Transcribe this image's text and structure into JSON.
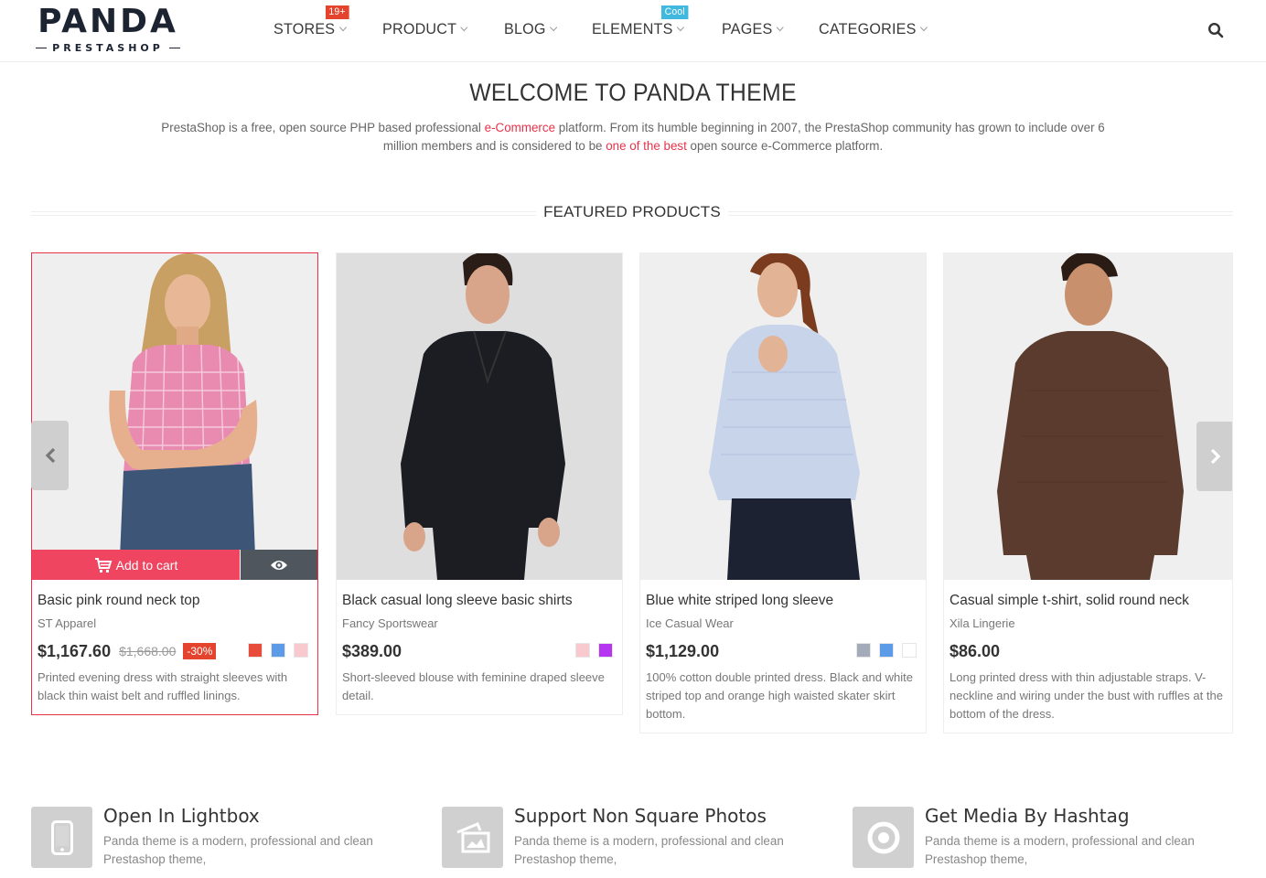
{
  "logo": {
    "main": "PANDA",
    "sub": "PRESTASHOP"
  },
  "nav": {
    "items": [
      {
        "label": "STORES",
        "badge": "19+",
        "badge_color": "#e4442d"
      },
      {
        "label": "PRODUCT"
      },
      {
        "label": "BLOG"
      },
      {
        "label": "ELEMENTS",
        "badge": "Cool",
        "badge_color": "#41b9de"
      },
      {
        "label": "PAGES"
      },
      {
        "label": "CATEGORIES"
      }
    ],
    "search_icon": "search-icon"
  },
  "welcome": {
    "title": "WELCOME TO PANDA THEME",
    "text_part1": "PrestaShop is a free, open source PHP based professional ",
    "link1": "e-Commerce",
    "text_part2": " platform. From its humble beginning in 2007, the PrestaShop community has grown to include over 6 million members and is considered to be ",
    "link2": "one of the best",
    "text_part3": " open source e-Commerce platform."
  },
  "featured": {
    "title": "FEATURED PRODUCTS",
    "prev_icon": "chevron-left-icon",
    "next_icon": "chevron-right-icon",
    "add_to_cart_label": "Add to cart",
    "products": [
      {
        "name": "Basic pink round neck top",
        "brand": "ST Apparel",
        "price": "$1,167.60",
        "old_price": "$1,668.00",
        "discount": "-30%",
        "swatches": [
          "#e84c3d",
          "#5b9be8",
          "#f8c9cf"
        ],
        "description": "Printed evening dress with straight sleeves with black thin waist belt and ruffled linings."
      },
      {
        "name": "Black casual long sleeve basic shirts",
        "brand": "Fancy Sportswear",
        "price": "$389.00",
        "swatches": [
          "#f8c9cf",
          "#b535f0"
        ],
        "description": "Short-sleeved blouse with feminine draped sleeve detail."
      },
      {
        "name": "Blue white striped long sleeve",
        "brand": "Ice Casual Wear",
        "price": "$1,129.00",
        "swatches": [
          "#a3abb8",
          "#5b9be8",
          "#ffffff"
        ],
        "description": "100% cotton double printed dress. Black and white striped top and orange high waisted skater skirt bottom."
      },
      {
        "name": "Casual simple t-shirt, solid round neck",
        "brand": "Xila Lingerie",
        "price": "$86.00",
        "swatches": [],
        "description": "Long printed dress with thin adjustable straps. V-neckline and wiring under the bust with ruffles at the bottom of the dress."
      }
    ]
  },
  "features": [
    {
      "icon": "mobile-phone-icon",
      "title": "Open In Lightbox",
      "description": "Panda theme is a modern, professional and clean Prestashop theme,"
    },
    {
      "icon": "photos-icon",
      "title": "Support Non Square Photos",
      "description": "Panda theme is a modern, professional and clean Prestashop theme,"
    },
    {
      "icon": "circle-target-icon",
      "title": "Get Media By Hashtag",
      "description": "Panda theme is a modern, professional and clean Prestashop theme,"
    }
  ],
  "colors": {
    "accent": "#ef4561",
    "dark_button": "#4f565e",
    "badge_red": "#e4442d",
    "badge_blue": "#41b9de"
  }
}
